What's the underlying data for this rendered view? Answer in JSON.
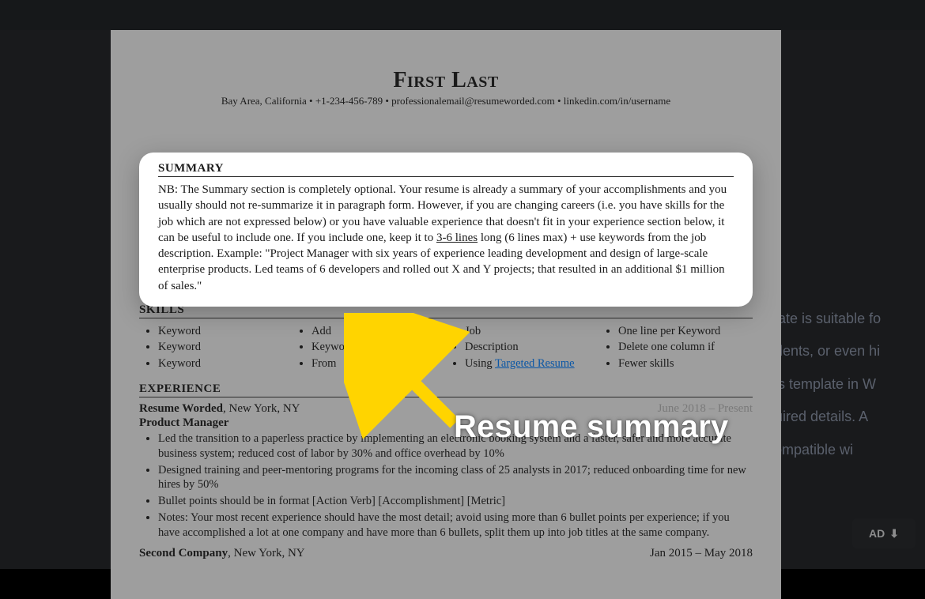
{
  "resume": {
    "name": "First Last",
    "contact": "Bay Area, California • +1-234-456-789 • professionalemail@resumeworded.com • linkedin.com/in/username",
    "summary": {
      "title": "SUMMARY",
      "body_prefix": "NB: The Summary section is completely optional. Your resume is already a summary of your accomplishments and you usually should not re-summarize it in paragraph form. However, if you are changing careers (i.e. you have skills for the job which are not expressed below) or you have valuable experience that doesn't fit in your experience section below, it can be useful to include one. If you include one, keep it to ",
      "body_underlined": "3-6 lines",
      "body_suffix": " long (6 lines max) + use keywords from the job description. Example: \"Project Manager with six years of experience leading development and design of large-scale enterprise products. Led teams of 6 developers and rolled out X and Y projects; that resulted in an additional $1 million of sales.\""
    },
    "skills": {
      "title": "SKILLS",
      "col1": [
        "Keyword",
        "Keyword",
        "Keyword"
      ],
      "col2": [
        "Add",
        "Keywords",
        "From"
      ],
      "col3_a": "Job",
      "col3_b": "Description",
      "col3_c_prefix": "Using ",
      "col3_c_link": "Targeted Resume",
      "col4": [
        "One line per Keyword",
        "Delete one column if",
        "Fewer skills"
      ]
    },
    "experience": {
      "title": "EXPERIENCE",
      "job1": {
        "company_line": "Resume Worded",
        "company_suffix": ", New York, NY",
        "date_faded": "June 2018 – Present",
        "role": "Product Manager",
        "bullets": [
          "Led the transition to a paperless practice by implementing an electronic booking system and a faster, safer and more accurate business system; reduced cost of labor by 30% and office overhead by 10%",
          "Designed training and peer-mentoring programs for the incoming class of 25 analysts in 2017; reduced onboarding time for new hires by 50%",
          "Bullet points should be in format [Action Verb] [Accomplishment] [Metric]",
          "Notes: Your most recent experience should have the most detail; avoid using more than 6 bullet points per experience; if you have accomplished a lot at one company and have more than 6 bullets, split them up into job titles at the same company."
        ]
      },
      "job2": {
        "company_line": "Second Company",
        "company_suffix": ", New York, NY",
        "date": "Jan 2015 – May 2018"
      }
    }
  },
  "annotation": "Resume summary",
  "side_panel": {
    "big_lines": [
      "plate is suitable fo",
      "udents, or even hi",
      "his template in W",
      "quired details. A",
      "compatible wi"
    ],
    "download": "AD"
  }
}
